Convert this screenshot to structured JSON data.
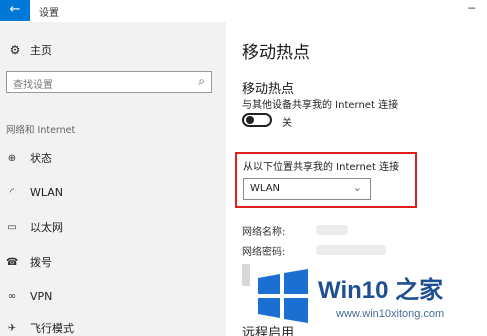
{
  "window": {
    "title": "设置",
    "back_icon": "arrow-left-icon"
  },
  "sidebar": {
    "home_label": "主页",
    "search_placeholder": "查找设置",
    "section_label": "网络和 Internet",
    "items": [
      {
        "icon": "globe-icon",
        "label": "状态"
      },
      {
        "icon": "wifi-icon",
        "label": "WLAN"
      },
      {
        "icon": "ethernet-icon",
        "label": "以太网"
      },
      {
        "icon": "dial-up-icon",
        "label": "拨号"
      },
      {
        "icon": "vpn-icon",
        "label": "VPN"
      },
      {
        "icon": "airplane-icon",
        "label": "飞行模式"
      }
    ]
  },
  "main": {
    "page_title": "移动热点",
    "section_title": "移动热点",
    "description": "与其他设备共享我的 Internet 连接",
    "toggle_state": "关",
    "toggle_on": false,
    "share_from_label": "从以下位置共享我的 Internet 连接",
    "share_from_value": "WLAN",
    "network_name_label": "网络名称:",
    "network_password_label": "网络密码:",
    "remote_label": "远程启用"
  },
  "watermark": {
    "title": "Win10 之家",
    "url": "www.win10xitong.com"
  },
  "colors": {
    "accent": "#0078d7",
    "highlight_border": "#e02020",
    "sidebar_bg": "#f2f2f2",
    "logo_blue": "#1a6fd0"
  }
}
